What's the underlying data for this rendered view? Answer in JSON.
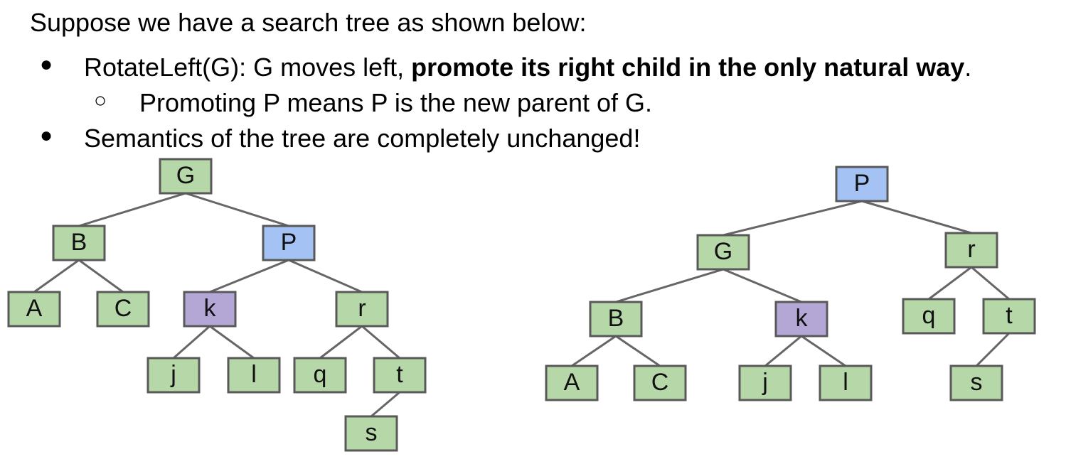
{
  "intro": "Suppose we have a search tree as shown below:",
  "bullets": {
    "b1_prefix": "RotateLeft(G): G moves left, ",
    "b1_bold": "promote its right child in the only natural way",
    "b1_suffix": ".",
    "b1_sub": "Promoting P means P is the new parent of G.",
    "b2": "Semantics of the tree are completely unchanged!",
    "bullet_glyph": "●",
    "sub_bullet_glyph": "○"
  },
  "colors": {
    "green": "#b6d7a8",
    "blue": "#a4c2f4",
    "purple": "#b4a7d6",
    "border": "#595959",
    "edge": "#666666"
  },
  "trees": [
    {
      "name": "before",
      "nodes": [
        {
          "id": "G",
          "label": "G",
          "color": "green"
        },
        {
          "id": "B",
          "label": "B",
          "color": "green"
        },
        {
          "id": "P",
          "label": "P",
          "color": "blue"
        },
        {
          "id": "A",
          "label": "A",
          "color": "green"
        },
        {
          "id": "C",
          "label": "C",
          "color": "green"
        },
        {
          "id": "k",
          "label": "k",
          "color": "purple"
        },
        {
          "id": "r",
          "label": "r",
          "color": "green"
        },
        {
          "id": "j",
          "label": "j",
          "color": "green"
        },
        {
          "id": "l",
          "label": "l",
          "color": "green"
        },
        {
          "id": "q",
          "label": "q",
          "color": "green"
        },
        {
          "id": "t",
          "label": "t",
          "color": "green"
        },
        {
          "id": "s",
          "label": "s",
          "color": "green"
        }
      ],
      "edges": [
        [
          "G",
          "B"
        ],
        [
          "G",
          "P"
        ],
        [
          "B",
          "A"
        ],
        [
          "B",
          "C"
        ],
        [
          "P",
          "k"
        ],
        [
          "P",
          "r"
        ],
        [
          "k",
          "j"
        ],
        [
          "k",
          "l"
        ],
        [
          "r",
          "q"
        ],
        [
          "r",
          "t"
        ],
        [
          "t",
          "s"
        ]
      ]
    },
    {
      "name": "after",
      "nodes": [
        {
          "id": "P",
          "label": "P",
          "color": "blue"
        },
        {
          "id": "G",
          "label": "G",
          "color": "green"
        },
        {
          "id": "r",
          "label": "r",
          "color": "green"
        },
        {
          "id": "B",
          "label": "B",
          "color": "green"
        },
        {
          "id": "k",
          "label": "k",
          "color": "purple"
        },
        {
          "id": "q",
          "label": "q",
          "color": "green"
        },
        {
          "id": "t",
          "label": "t",
          "color": "green"
        },
        {
          "id": "A",
          "label": "A",
          "color": "green"
        },
        {
          "id": "C",
          "label": "C",
          "color": "green"
        },
        {
          "id": "j",
          "label": "j",
          "color": "green"
        },
        {
          "id": "l",
          "label": "l",
          "color": "green"
        },
        {
          "id": "s",
          "label": "s",
          "color": "green"
        }
      ],
      "edges": [
        [
          "P",
          "G"
        ],
        [
          "P",
          "r"
        ],
        [
          "G",
          "B"
        ],
        [
          "G",
          "k"
        ],
        [
          "B",
          "A"
        ],
        [
          "B",
          "C"
        ],
        [
          "k",
          "j"
        ],
        [
          "k",
          "l"
        ],
        [
          "r",
          "q"
        ],
        [
          "r",
          "t"
        ],
        [
          "t",
          "s"
        ]
      ]
    }
  ]
}
